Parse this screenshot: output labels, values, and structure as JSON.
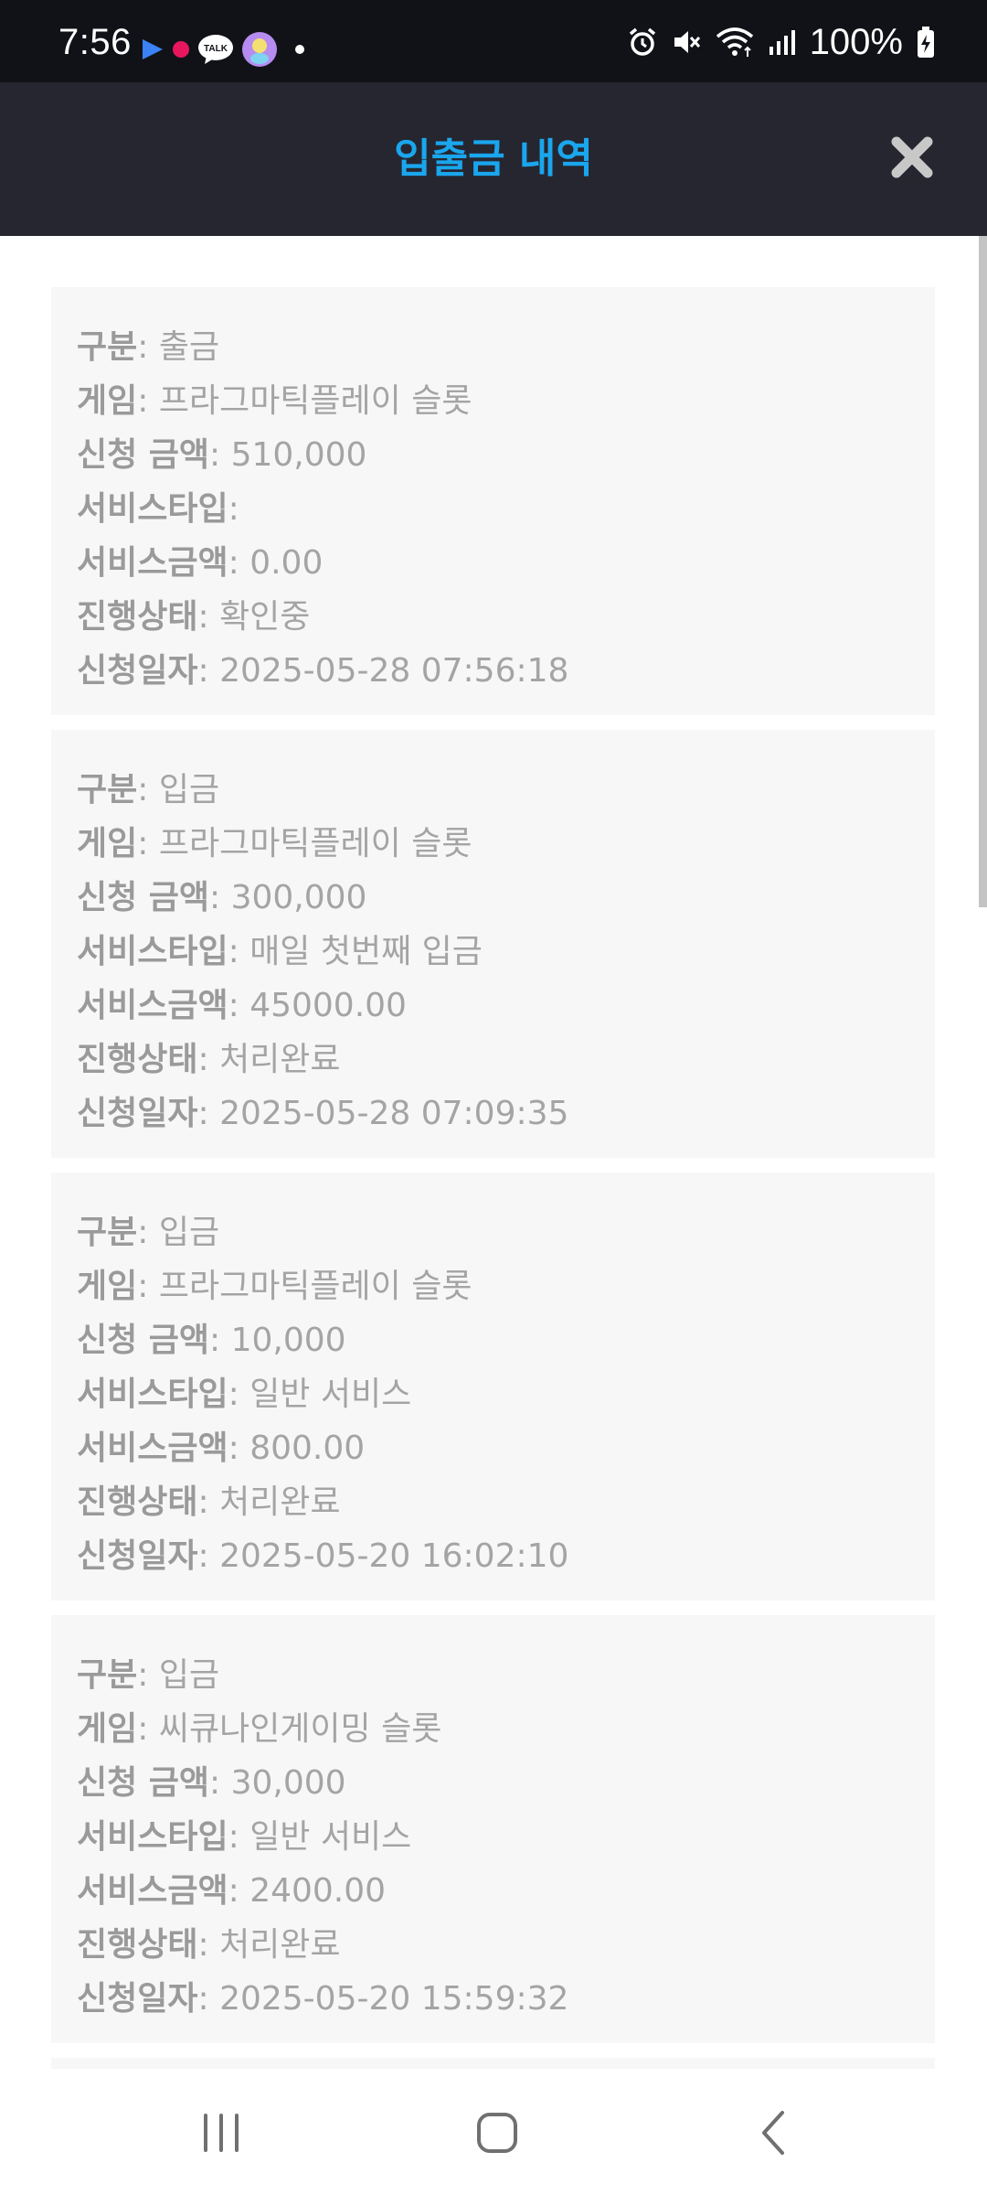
{
  "status_bar": {
    "time": "7:56",
    "talk_label": "TALK",
    "battery": "100%"
  },
  "header": {
    "title": "입출금 내역"
  },
  "labels": {
    "type": "구분",
    "game": "게임",
    "amount": "신청 금액",
    "service_type": "서비스타입",
    "service_amount": "서비스금액",
    "status": "진행상태",
    "date": "신청일자"
  },
  "records": [
    {
      "type": "출금",
      "game": "프라그마틱플레이 슬롯",
      "amount": "510,000",
      "service_type": "",
      "service_amount": "0.00",
      "status": "확인중",
      "date": "2025-05-28 07:56:18"
    },
    {
      "type": "입금",
      "game": "프라그마틱플레이 슬롯",
      "amount": "300,000",
      "service_type": "매일 첫번째 입금",
      "service_amount": "45000.00",
      "status": "처리완료",
      "date": "2025-05-28 07:09:35"
    },
    {
      "type": "입금",
      "game": "프라그마틱플레이 슬롯",
      "amount": "10,000",
      "service_type": "일반 서비스",
      "service_amount": "800.00",
      "status": "처리완료",
      "date": "2025-05-20 16:02:10"
    },
    {
      "type": "입금",
      "game": "씨큐나인게이밍 슬롯",
      "amount": "30,000",
      "service_type": "일반 서비스",
      "service_amount": "2400.00",
      "status": "처리완료",
      "date": "2025-05-20 15:59:32"
    }
  ],
  "colors": {
    "status_bar_bg": "#111218",
    "header_bg": "#262630",
    "accent": "#1aa6ee",
    "card_bg": "#f7f7f7",
    "text_muted": "#a4a4a4"
  },
  "icons": {
    "close": "close-icon",
    "alarm": "alarm-icon",
    "mute": "mute-icon",
    "wifi": "wifi-icon",
    "signal": "signal-icon",
    "battery": "battery-charging-icon",
    "recent": "recent-apps-icon",
    "home": "home-icon",
    "back": "back-icon"
  }
}
